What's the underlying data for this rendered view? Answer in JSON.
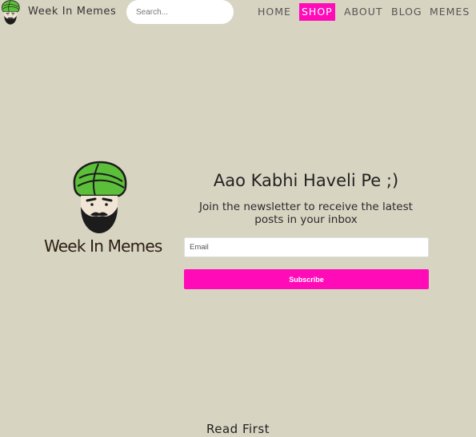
{
  "header": {
    "brand_name": "Week In Memes",
    "search": {
      "placeholder": "Search...",
      "value": ""
    },
    "nav": [
      {
        "label": "HOME",
        "active": false
      },
      {
        "label": "SHOP",
        "active": true
      },
      {
        "label": "ABOUT",
        "active": false
      },
      {
        "label": "BLOG",
        "active": false
      },
      {
        "label": "MEMES",
        "active": false
      }
    ]
  },
  "hero": {
    "wordmark": "Week In Memes",
    "newsletter": {
      "title": "Aao Kabhi Haveli Pe ;)",
      "subtitle": "Join the newsletter to receive the latest posts in your inbox",
      "email_placeholder": "Email",
      "email_value": "",
      "button_label": "Subscribe"
    }
  },
  "section": {
    "heading": "Read First"
  },
  "colors": {
    "background": "#d8d4c2",
    "accent": "#ff0bb8",
    "turban": "#5cbf3a",
    "wordmark": "#2b1d14"
  },
  "icons": {
    "brand_logo": "turbaned-man-icon",
    "hero_logo": "turbaned-man-icon"
  }
}
